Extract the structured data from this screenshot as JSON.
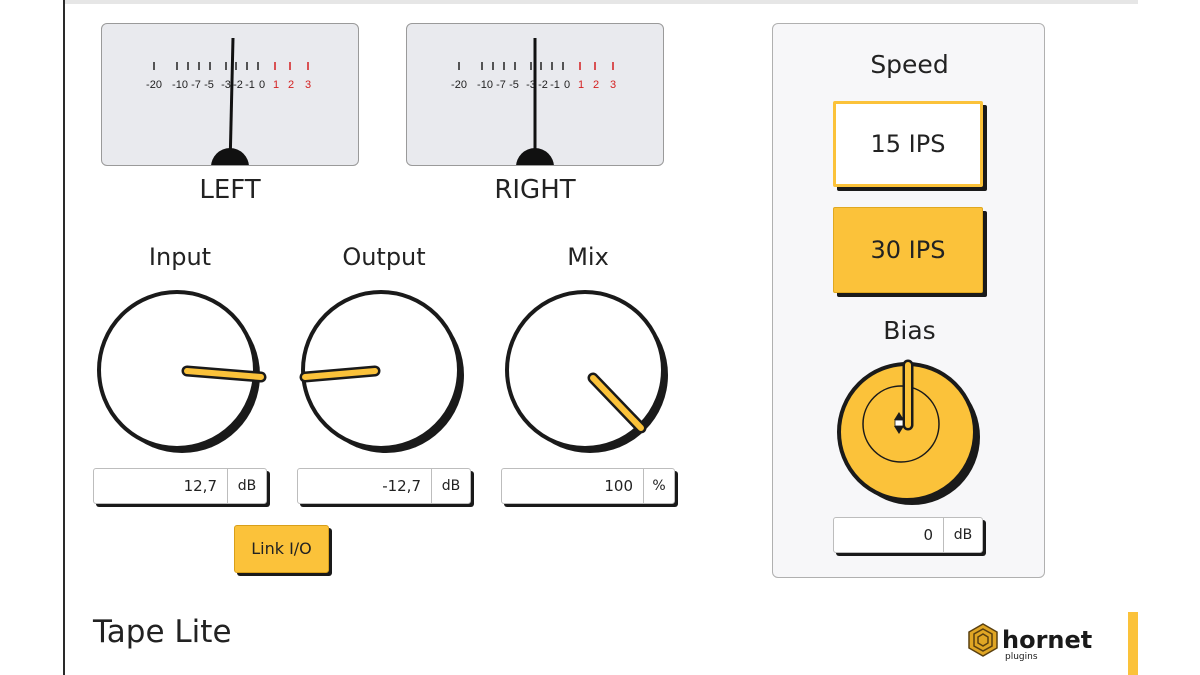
{
  "meters": {
    "left_label": "LEFT",
    "right_label": "RIGHT",
    "scale": [
      "-20",
      "-10",
      "-7",
      "-5",
      "-3",
      "-2",
      "-1",
      "0",
      "1",
      "2",
      "3"
    ]
  },
  "knobs": {
    "input": {
      "label": "Input",
      "value": "12,7",
      "unit": "dB"
    },
    "output": {
      "label": "Output",
      "value": "-12,7",
      "unit": "dB"
    },
    "mix": {
      "label": "Mix",
      "value": "100",
      "unit": "%"
    }
  },
  "link_button": "Link I/O",
  "speed": {
    "title": "Speed",
    "option_15": "15 IPS",
    "option_30": "30 IPS",
    "selected": "30 IPS"
  },
  "bias": {
    "label": "Bias",
    "value": "0",
    "unit": "dB"
  },
  "brand_name": "Tape Lite",
  "logo": {
    "wordmark": "hornet",
    "sub": "plugins"
  },
  "colors": {
    "accent": "#fbc23a",
    "dark": "#1a1a1a",
    "scale_red": "#d42020"
  }
}
